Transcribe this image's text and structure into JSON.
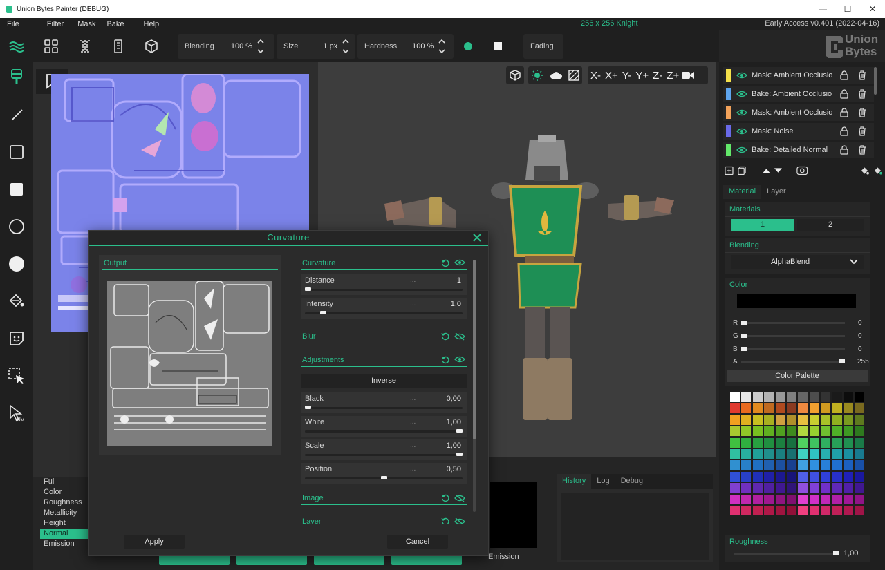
{
  "window": {
    "title": "Union Bytes Painter (DEBUG)",
    "minimize": "—",
    "maximize": "☐",
    "close": "✕"
  },
  "menu": {
    "items": [
      "File",
      "Filter",
      "Mask",
      "Bake",
      "Help"
    ],
    "project_info": "256 x 256   Knight",
    "version": "Early Access v0.401 (2022-04-16)"
  },
  "toolbar": {
    "blending_label": "Blending",
    "blending_value": "100 %",
    "size_label": "Size",
    "size_value": "1 px",
    "hardness_label": "Hardness",
    "hardness_value": "100 %",
    "fading_label": "Fading"
  },
  "logo": {
    "line1": "Union",
    "line2": "Bytes"
  },
  "viewport": {
    "axes": [
      "X-",
      "X+",
      "Y-",
      "Y+",
      "Z-",
      "Z+"
    ]
  },
  "layers": [
    {
      "label": "Mask: Ambient Occlusion",
      "color": "#f4e04a"
    },
    {
      "label": "Bake: Ambient Occlusion",
      "color": "#5ea5ee"
    },
    {
      "label": "Mask: Ambient Occlusion",
      "color": "#f2a25a"
    },
    {
      "label": "Mask: Noise",
      "color": "#6a6ae8"
    },
    {
      "label": "Bake: Detailed Normal",
      "color": "#63e86a"
    }
  ],
  "right_tabs": {
    "material": "Material",
    "layer": "Layer"
  },
  "materials": {
    "title": "Materials",
    "option1": "1",
    "option2": "2"
  },
  "blending": {
    "title": "Blending",
    "value": "AlphaBlend"
  },
  "color": {
    "title": "Color",
    "r_label": "R",
    "r_value": "0",
    "g_label": "G",
    "g_value": "0",
    "b_label": "B",
    "b_value": "0",
    "a_label": "A",
    "a_value": "255",
    "palette_button": "Color Palette"
  },
  "roughness": {
    "title": "Roughness",
    "value": "1,00"
  },
  "channels": [
    "Full",
    "Color",
    "Roughness",
    "Metallicity",
    "Height",
    "Normal",
    "Emission"
  ],
  "active_channel": "Normal",
  "bottom_tabs": [
    "History",
    "Log",
    "Debug"
  ],
  "emission_label": "Emission",
  "dialog": {
    "title": "Curvature",
    "output_title": "Output",
    "groups": {
      "curvature": "Curvature",
      "blur": "Blur",
      "adjustments": "Adjustments",
      "image": "Image",
      "layer": "Layer"
    },
    "params": {
      "distance": {
        "name": "Distance",
        "value": "1",
        "level": 0.0
      },
      "intensity": {
        "name": "Intensity",
        "value": "1,0",
        "level": 0.1
      },
      "black": {
        "name": "Black",
        "value": "0,00",
        "level": 0.0
      },
      "white": {
        "name": "White",
        "value": "1,00",
        "level": 1.0
      },
      "scale": {
        "name": "Scale",
        "value": "1,00",
        "level": 1.0
      },
      "position": {
        "name": "Position",
        "value": "0,50",
        "level": 0.5
      }
    },
    "dots": "...",
    "inverse": "Inverse",
    "apply": "Apply",
    "cancel": "Cancel"
  },
  "accent_color": "#2bbf8c"
}
